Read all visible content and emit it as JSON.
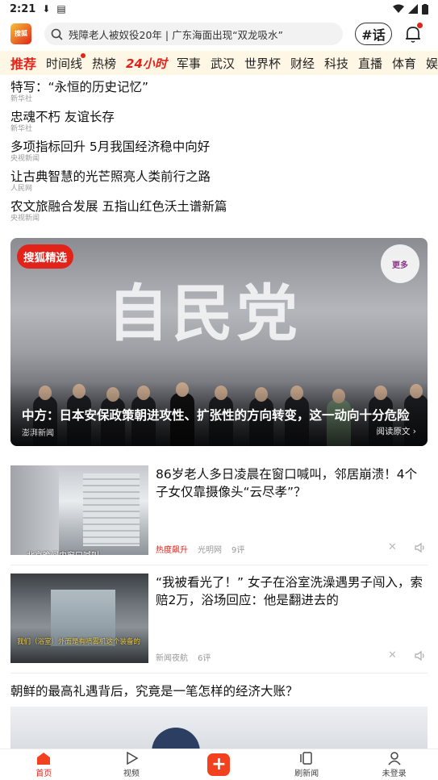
{
  "status_bar": {
    "time": "2:21"
  },
  "header": {
    "logo_text": "搜狐",
    "search_placeholder": "残障老人被奴役20年 | 广东海面出现“双龙吸水”",
    "topic_button": "#话"
  },
  "channels": [
    "推荐",
    "时间线",
    "热榜",
    "24小时",
    "军事",
    "武汉",
    "世界杯",
    "财经",
    "科技",
    "直播",
    "体育",
    "娱"
  ],
  "headlines": [
    {
      "title": "特写：“永恒的历史记忆”",
      "source": "新华社"
    },
    {
      "title": "忠魂不朽 友谊长存",
      "source": "新华社"
    },
    {
      "title": "多项指标回升 5月我国经济稳中向好",
      "source": "央视新闻"
    },
    {
      "title": "让古典智慧的光芒照亮人类前行之路",
      "source": "人民网"
    },
    {
      "title": "农文旅融合发展 五指山红色沃土谱新篇",
      "source": "央视新闻"
    }
  ],
  "feature": {
    "badge": "搜狐精选",
    "more": "更多",
    "image_text": "自民党",
    "title": "中方：日本安保政策朝进攻性、扩张性的方向转变，这一动向十分危险",
    "source": "澎湃新闻",
    "read_original": "阅读原文 ›"
  },
  "news_items": [
    {
      "title": "86岁老人多日凌晨在窗口喊叫，邻居崩溃！4个子女仅靠摄像头“云尽孝”？",
      "hot_tag": "热度飙升",
      "source": "光明网",
      "comments": "9评",
      "thumb_caption": "北京晚间内窗口喊叫"
    },
    {
      "title": "“我被看光了！” 女子在浴室洗澡遇男子闯入，索赔2万，浴场回应：他是翻进去的",
      "hot_tag": "",
      "source": "新闻夜航",
      "comments": "6评",
      "thumb_caption": "我们（浴室）外面是有喷雾机这个装备的"
    }
  ],
  "long_item": {
    "title": "朝鲜的最高礼遇背后，究竟是一笔怎样的经济大账？"
  },
  "bottom_nav": [
    {
      "label": "首页",
      "icon": "home-icon",
      "active": true
    },
    {
      "label": "视频",
      "icon": "play-icon",
      "active": false
    },
    {
      "label": "+",
      "icon": "publish-icon",
      "active": false
    },
    {
      "label": "刷新闻",
      "icon": "cards-icon",
      "active": false
    },
    {
      "label": "未登录",
      "icon": "user-icon",
      "active": false
    }
  ],
  "colors": {
    "brand_red": "#e2231a",
    "channel_bar_bg": "#fff7e6"
  }
}
